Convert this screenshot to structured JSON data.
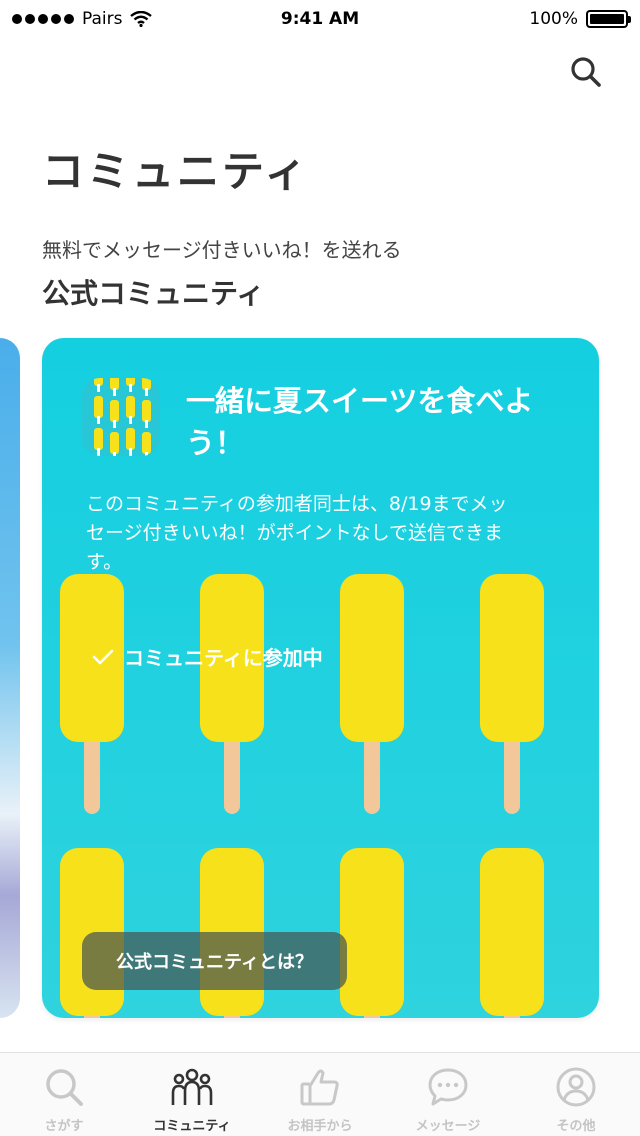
{
  "status_bar": {
    "carrier": "Pairs",
    "time": "9:41 AM",
    "battery": "100%",
    "battery_level": 1.0
  },
  "header": {
    "title": "コミュニティ"
  },
  "section": {
    "subtitle": "無料でメッセージ付きいいね！を送れる",
    "title": "公式コミュニティ"
  },
  "card": {
    "title": "一緒に夏スイーツを食べよう！",
    "description": "このコミュニティの参加者同士は、8/19までメッセージ付きいいね！がポイントなしで送信できます。",
    "joined_label": "コミュニティに参加中",
    "about_button": "公式コミュニティとは？",
    "colors": {
      "background": "#14cfe0",
      "popsicle": "#f7e11a",
      "stick": "#f2c89a"
    }
  },
  "tabs": [
    {
      "label": "さがす",
      "icon": "search-icon",
      "active": false
    },
    {
      "label": "コミュニティ",
      "icon": "community-icon",
      "active": true
    },
    {
      "label": "お相手から",
      "icon": "thumbs-up-icon",
      "active": false
    },
    {
      "label": "メッセージ",
      "icon": "chat-bubble-icon",
      "active": false
    },
    {
      "label": "その他",
      "icon": "profile-icon",
      "active": false
    }
  ]
}
